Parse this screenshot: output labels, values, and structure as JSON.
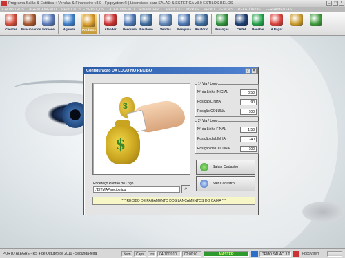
{
  "window": {
    "title": "Programa Salão & Estética + Vendas & Financeiro v3.0 - Fpqsystem ® | Licenciado para SALÃO & ESTÉTICA v3.0 ESTILOS BELOS"
  },
  "menu": [
    "CADASTROS",
    "AGENDAMENTO",
    "PRODUTOS E SERVIÇOS",
    "ATENDIMENTO",
    "FINANCEIRO",
    "PEDIDO COMPRAS",
    "PEDIDO VENDAS",
    "RELATÓRIOS",
    "FERRAMENTAS"
  ],
  "toolbar": [
    {
      "label": "Clientes",
      "icon": "clients-icon",
      "color": "#d24b3a"
    },
    {
      "label": "Funcionários",
      "icon": "employees-icon",
      "color": "#a7562c"
    },
    {
      "label": "Fornece",
      "icon": "suppliers-icon",
      "color": "#5979b8"
    },
    {
      "label": "Agenda",
      "icon": "agenda-icon",
      "color": "#3b7dc7"
    },
    {
      "label": "Produtos",
      "icon": "products-icon",
      "color": "#d69a2a",
      "selected": true
    },
    {
      "label": "Atender",
      "icon": "attend-icon",
      "color": "#c83030"
    },
    {
      "label": "Pesquisa",
      "icon": "search-icon",
      "color": "#4a74b0"
    },
    {
      "label": "Relatório",
      "icon": "report-icon",
      "color": "#3c6a9c"
    },
    {
      "label": "Vendas",
      "icon": "sales-icon",
      "color": "#5c82b4"
    },
    {
      "label": "Pesquisa",
      "icon": "search-icon",
      "color": "#4a74b0"
    },
    {
      "label": "Relatório",
      "icon": "report-icon",
      "color": "#3c6a9c"
    },
    {
      "label": "Finanças",
      "icon": "finance-icon",
      "color": "#2d8f3a"
    },
    {
      "label": "CAIXA",
      "icon": "cash-icon",
      "color": "#1c3c70"
    },
    {
      "label": "Receber",
      "icon": "receive-icon",
      "color": "#23a04a"
    },
    {
      "label": "A Pagar",
      "icon": "pay-icon",
      "color": "#d8403a"
    },
    {
      "label": "",
      "icon": "settings-icon",
      "color": "#c99a2c"
    },
    {
      "label": "",
      "icon": "exit-icon",
      "color": "#3d9a3a"
    }
  ],
  "dialog": {
    "title": "Configuração DA LOGO NO RECIBO",
    "logo_path_label": "Endereço Padrão do Logo",
    "logo_path": ".\\BITMAP\\recibo.jpg",
    "via1": {
      "title": "1ª Via / Logo",
      "rows": [
        {
          "label": "Nº da Linha INICIAL",
          "value": "0,50"
        },
        {
          "label": "Posição LINHA",
          "value": "90"
        },
        {
          "label": "Posição COLUNA",
          "value": "100"
        }
      ]
    },
    "via2": {
      "title": "2ª Via / Logo",
      "rows": [
        {
          "label": "Nº da Linha FINAL",
          "value": "1,50"
        },
        {
          "label": "Posição da LINHA",
          "value": "1740"
        },
        {
          "label": "Posição da COLUNA",
          "value": "100"
        }
      ]
    },
    "save_label": "Salvar Cadastro",
    "exit_label": "Sair Cadastro",
    "footer": "*** RECIBO DE PAGAMENTO DOS LANÇAMENTOS DO CAIXA ***"
  },
  "status": {
    "location": "PORTO ALEGRE - RS  4 de Outubro de 2010 - Segunda-feira",
    "num": "Num",
    "caps": "Caps",
    "ins": "Ins",
    "date": "04/10/2010",
    "time": "02:00:01",
    "master": "MASTER",
    "demo": "DEMO SALÃO 3.0",
    "brand": "FpqSystem"
  }
}
